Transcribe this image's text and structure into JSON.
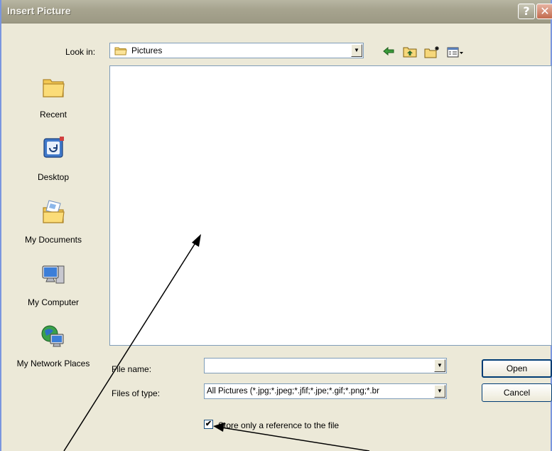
{
  "window": {
    "title": "Insert Picture",
    "help_glyph": "?",
    "close_glyph": "✕"
  },
  "lookin": {
    "label": "Look in:",
    "value": "Pictures"
  },
  "toolbar": {
    "icons": [
      "back-arrow-icon",
      "up-one-level-icon",
      "new-folder-icon",
      "views-menu-icon"
    ]
  },
  "places": [
    {
      "label": "Recent",
      "icon": "recent-folder-icon"
    },
    {
      "label": "Desktop",
      "icon": "desktop-icon"
    },
    {
      "label": "My Documents",
      "icon": "my-documents-icon"
    },
    {
      "label": "My Computer",
      "icon": "my-computer-icon"
    },
    {
      "label": "My Network Places",
      "icon": "network-places-icon"
    }
  ],
  "filename": {
    "label": "File name:",
    "value": ""
  },
  "filetype": {
    "label": "Files of type:",
    "value": "All Pictures (*.jpg;*.jpeg;*.jfif;*.jpe;*.gif;*.png;*.br"
  },
  "reference_checkbox": {
    "label": "Store only a reference to the file",
    "checked": true
  },
  "buttons": {
    "open": "Open",
    "cancel": "Cancel"
  }
}
